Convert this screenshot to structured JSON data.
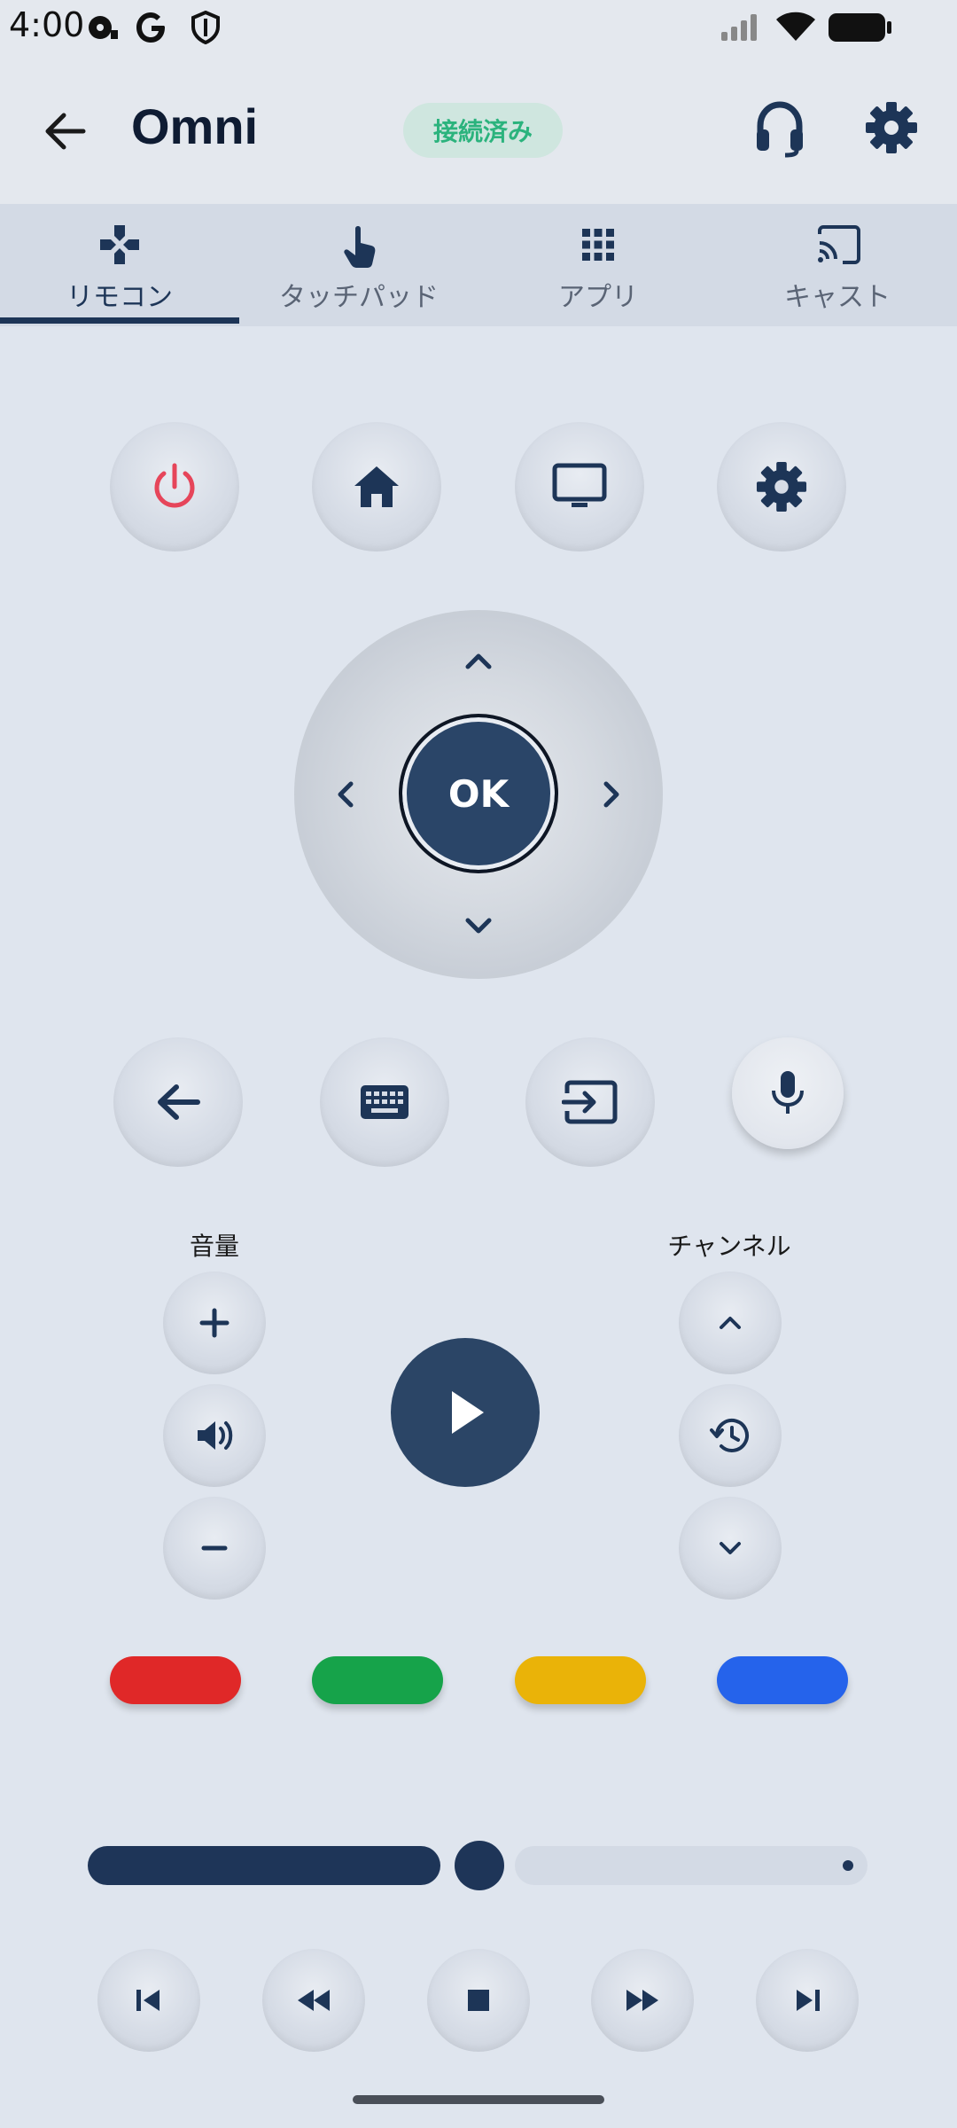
{
  "status_bar": {
    "time": "4:00",
    "icons": [
      "media-icon",
      "google-icon",
      "shield-icon",
      "signal-icon",
      "wifi-icon",
      "battery-icon"
    ]
  },
  "header": {
    "title": "Omni",
    "status_badge": "接続済み",
    "back_icon": "arrow-left-icon",
    "actions": [
      "headset-icon",
      "gear-icon"
    ]
  },
  "tabs": [
    {
      "label": "リモコン",
      "icon": "gamepad-icon",
      "active": true
    },
    {
      "label": "タッチパッド",
      "icon": "touch-icon",
      "active": false
    },
    {
      "label": "アプリ",
      "icon": "apps-grid-icon",
      "active": false
    },
    {
      "label": "キャスト",
      "icon": "cast-icon",
      "active": false
    }
  ],
  "top_buttons": [
    "power-icon",
    "home-icon",
    "tv-icon",
    "settings-icon"
  ],
  "dpad": {
    "ok_label": "OK"
  },
  "function_buttons": [
    "back-icon",
    "keyboard-icon",
    "input-source-icon",
    "mic-icon"
  ],
  "volume": {
    "label": "音量"
  },
  "channel": {
    "label": "チャンネル"
  },
  "color_keys": {
    "red": "#e02828",
    "green": "#16a34a",
    "yellow": "#eab308",
    "blue": "#2563eb"
  },
  "colors": {
    "accent": "#1d3557",
    "power": "#e6455a",
    "badge_text": "#2bb37d",
    "badge_bg": "#cfe6df"
  },
  "playback": {
    "progress": 0.5
  },
  "transport_buttons": [
    "skip-previous-icon",
    "rewind-icon",
    "stop-icon",
    "fast-forward-icon",
    "skip-next-icon"
  ]
}
